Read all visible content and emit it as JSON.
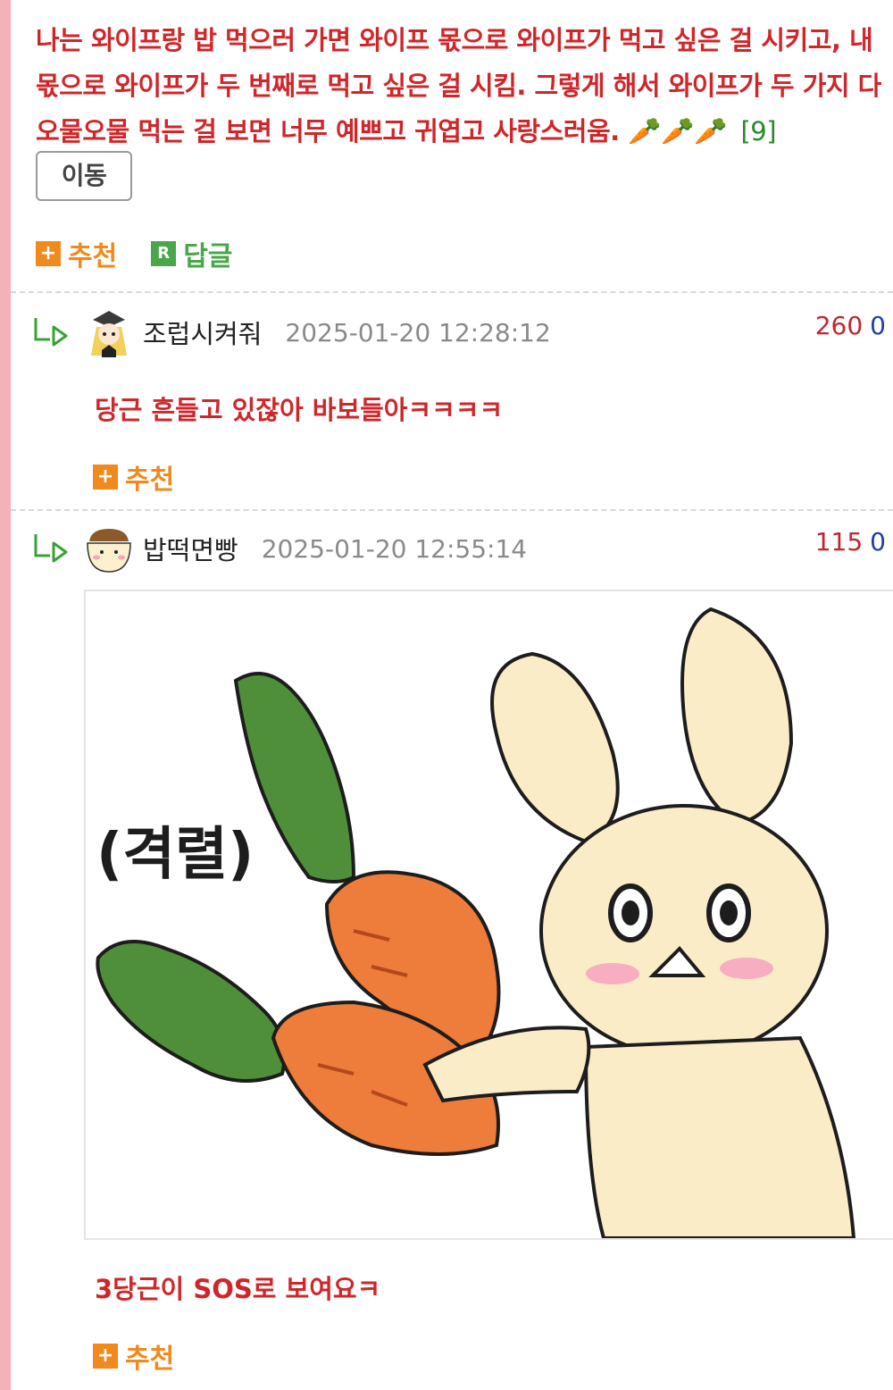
{
  "post": {
    "text": "나는 와이프랑 밥 먹으러 가면 와이프 몫으로 와이프가 먹고 싶은 걸 시키고, 내 몫으로 와이프가 두 번째로 먹고 싶은 걸 시킴. 그렇게 해서 와이프가 두 가지 다 오물오물 먹는 걸 보면 너무 예쁘고 귀엽고 사랑스러움.",
    "emoji": "🥕🥕🥕",
    "reply_count": "[9]",
    "move_label": "이동",
    "recommend_label": "추천",
    "reply_label": "답글",
    "recommend_icon": "+",
    "reply_icon": "R"
  },
  "comments": [
    {
      "nickname": "조럽시켜줘",
      "timestamp": "2025-01-20 12:28:12",
      "upvotes": "260",
      "downvotes": "0",
      "text": "당근 흔들고 있잖아 바보들아ㅋㅋㅋㅋ",
      "recommend_label": "추천",
      "recommend_icon": "+"
    },
    {
      "nickname": "밥떡면빵",
      "timestamp": "2025-01-20 12:55:14",
      "upvotes": "115",
      "downvotes": "0",
      "image_caption": "(격렬)",
      "text": "3당근이 SOS로 보여요ㅋ",
      "recommend_label": "추천",
      "recommend_icon": "+"
    }
  ],
  "colors": {
    "post_text": "#d0262a",
    "recommend": "#f08a1c",
    "reply": "#4aa64a",
    "upvote": "#c0272d",
    "downvote": "#1f3fa8",
    "left_bar": "#f3b1b8"
  },
  "icons": [
    "reply-arrow-icon",
    "avatar-icon",
    "carrot-emoji",
    "plus-icon",
    "r-icon"
  ]
}
